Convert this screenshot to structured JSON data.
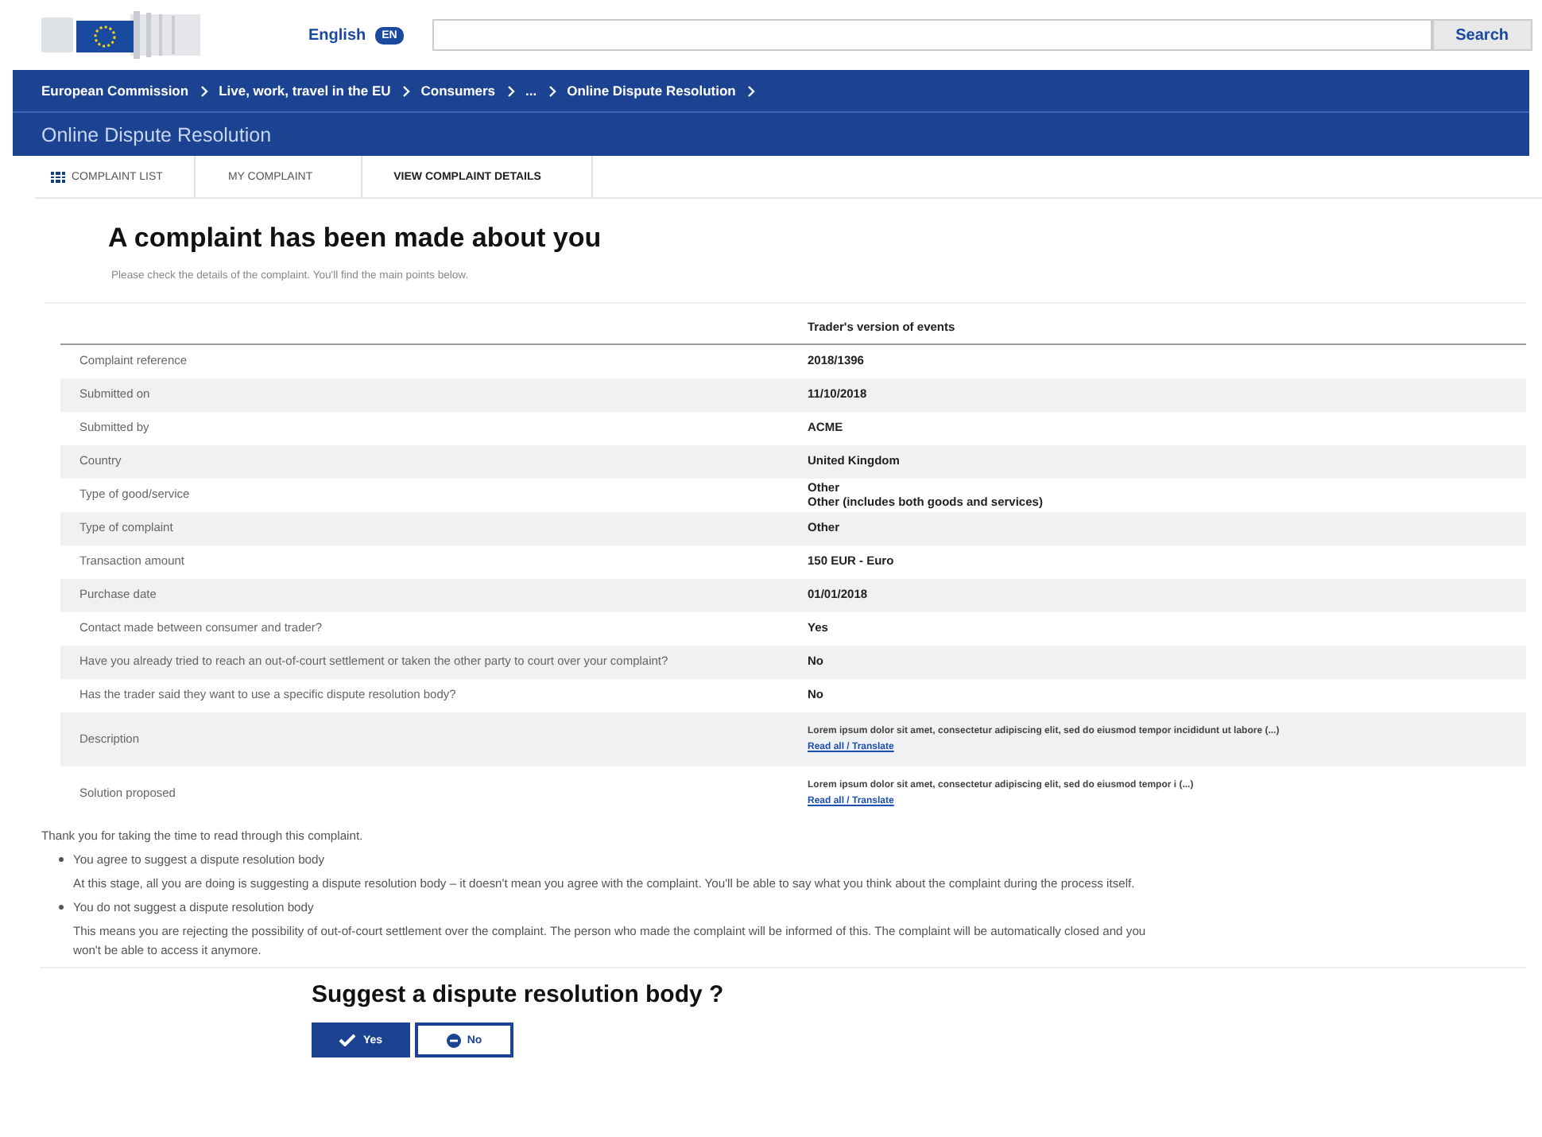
{
  "header": {
    "language": "English",
    "language_code": "EN",
    "search": {
      "button": "Search"
    }
  },
  "breadcrumb": [
    "European Commission",
    "Live, work, travel in the EU",
    "Consumers",
    "...",
    "Online Dispute Resolution"
  ],
  "site_title": "Online Dispute Resolution",
  "tabs": [
    {
      "label": "COMPLAINT LIST",
      "selected": false,
      "icon": true
    },
    {
      "label": "MY COMPLAINT",
      "selected": false,
      "icon": false
    },
    {
      "label": "VIEW COMPLAINT DETAILS",
      "selected": true,
      "icon": false
    }
  ],
  "heading": "A complaint has been made about you",
  "intro": "Please check the details of the complaint. You'll find the main points below.",
  "table": {
    "column_header": "Trader's version of events",
    "rows": [
      {
        "label": "Complaint reference",
        "values": [
          "2018/1396"
        ]
      },
      {
        "label": "Submitted on",
        "values": [
          "11/10/2018"
        ]
      },
      {
        "label": "Submitted by",
        "values": [
          "ACME"
        ]
      },
      {
        "label": "Country",
        "values": [
          "United Kingdom"
        ]
      },
      {
        "label": "Type of good/service",
        "values": [
          "Other",
          "Other (includes both goods and services)"
        ]
      },
      {
        "label": "Type of complaint",
        "values": [
          "Other"
        ]
      },
      {
        "label": "Transaction amount",
        "values": [
          "150 EUR - Euro"
        ]
      },
      {
        "label": "Purchase date",
        "values": [
          "01/01/2018"
        ]
      },
      {
        "label": "Contact made between consumer and trader?",
        "values": [
          "Yes"
        ]
      },
      {
        "label": "Have you already tried to reach an out-of-court settlement or taken the other party to court over your complaint?",
        "values": [
          "No"
        ]
      },
      {
        "label": "Has the trader said they want to use a specific dispute resolution body?",
        "values": [
          "No"
        ]
      },
      {
        "label": "Description",
        "kind": "long",
        "values": [
          "Lorem ipsum dolor sit amet, consectetur adipiscing elit, sed do eiusmod tempor incididunt ut labore (...)"
        ],
        "link": "Read all / Translate"
      },
      {
        "label": "Solution proposed",
        "kind": "long",
        "values": [
          "Lorem ipsum dolor sit amet, consectetur adipiscing elit, sed do eiusmod tempor i (...)"
        ],
        "link": "Read all / Translate"
      }
    ]
  },
  "thanks": "Thank you for taking the time to read through this complaint.",
  "options": [
    {
      "title": "You agree to suggest a dispute resolution body",
      "text": "At this stage, all you are doing is suggesting a dispute resolution body – it doesn't mean you agree with the complaint. You'll be able to say what you think about the complaint during the process itself."
    },
    {
      "title": "You do not suggest a dispute resolution body",
      "text": "This means you are rejecting the possibility of out-of-court settlement over the complaint. The person who made the complaint will be informed of this. The complaint will be automatically closed and you won't be able to access it anymore."
    }
  ],
  "question": "Suggest a dispute resolution body ?",
  "answers": [
    {
      "label": "Yes",
      "kind": "yes",
      "selected": true
    },
    {
      "label": "No",
      "kind": "no",
      "selected": false
    }
  ]
}
